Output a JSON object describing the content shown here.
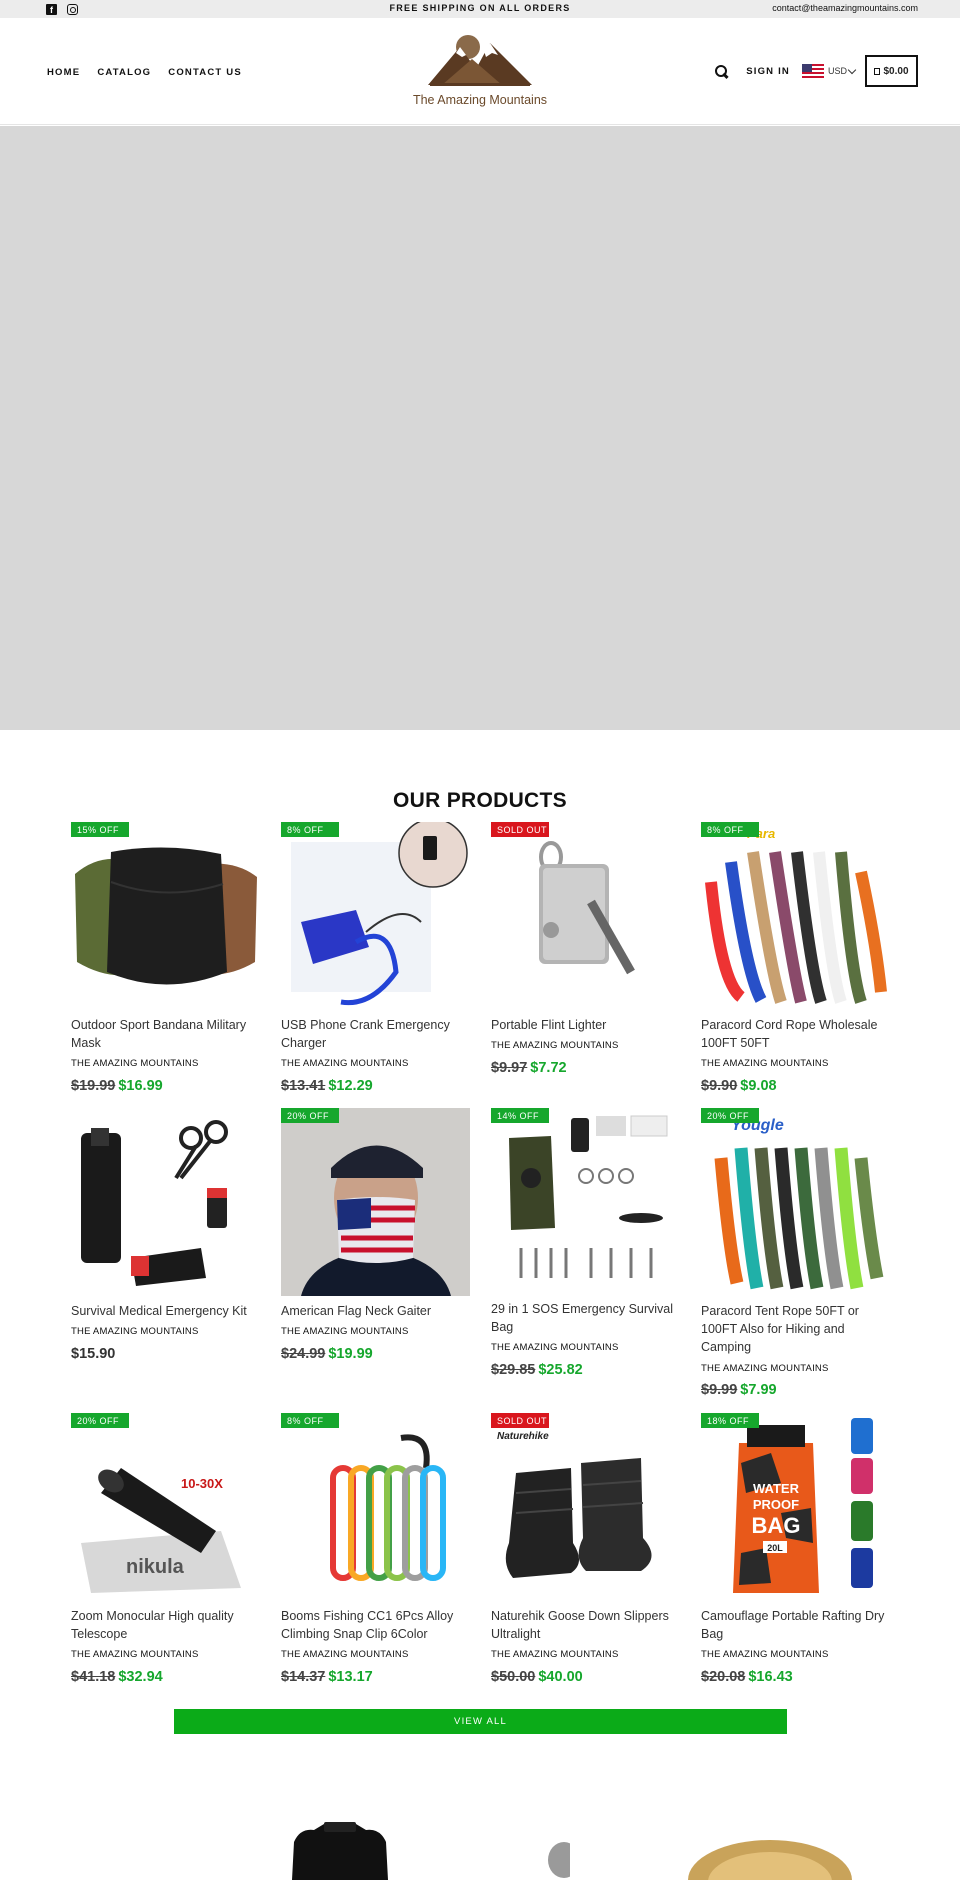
{
  "announcement": {
    "text": "FREE SHIPPING ON ALL ORDERS",
    "email": "contact@theamazingmountains.com"
  },
  "nav": [
    "HOME",
    "CATALOG",
    "CONTACT US"
  ],
  "brand": "The Amazing Mountains",
  "header": {
    "signin": "SIGN IN",
    "currency": "USD",
    "cart_total": "$0.00"
  },
  "section_title": "OUR PRODUCTS",
  "products": [
    {
      "title": "Outdoor Sport Bandana Military Mask",
      "vendor": "THE AMAZING MOUNTAINS",
      "old": "$19.99",
      "new": "$16.99",
      "badge": "15% OFF"
    },
    {
      "title": "USB Phone Crank Emergency Charger",
      "vendor": "THE AMAZING MOUNTAINS",
      "old": "$13.41",
      "new": "$12.29",
      "badge": "8% OFF"
    },
    {
      "title": "Portable Flint Lighter",
      "vendor": "THE AMAZING MOUNTAINS",
      "old": "$9.97",
      "new": "$7.72",
      "badge": "SOLD OUT"
    },
    {
      "title": "Paracord Cord Rope Wholesale 100FT 50FT",
      "vendor": "THE AMAZING MOUNTAINS",
      "old": "$9.90",
      "new": "$9.08",
      "badge": "8% OFF"
    },
    {
      "title": "Survival Medical Emergency Kit",
      "vendor": "THE AMAZING MOUNTAINS",
      "old": "",
      "new": "$15.90",
      "badge": ""
    },
    {
      "title": "American Flag Neck Gaiter",
      "vendor": "THE AMAZING MOUNTAINS",
      "old": "$24.99",
      "new": "$19.99",
      "badge": "20% OFF"
    },
    {
      "title": "29 in 1 SOS Emergency Survival Bag",
      "vendor": "THE AMAZING MOUNTAINS",
      "old": "$29.85",
      "new": "$25.82",
      "badge": "14% OFF"
    },
    {
      "title": "Paracord Tent Rope 50FT or 100FT Also for Hiking and Camping",
      "vendor": "THE AMAZING MOUNTAINS",
      "old": "$9.99",
      "new": "$7.99",
      "badge": "20% OFF"
    },
    {
      "title": "Zoom Monocular High quality Telescope",
      "vendor": "THE AMAZING MOUNTAINS",
      "old": "$41.18",
      "new": "$32.94",
      "badge": "20% OFF"
    },
    {
      "title": "Booms Fishing CC1 6Pcs Alloy Climbing Snap Clip 6Color",
      "vendor": "THE AMAZING MOUNTAINS",
      "old": "$14.37",
      "new": "$13.17",
      "badge": "8% OFF"
    },
    {
      "title": "Naturehik Goose Down Slippers Ultralight",
      "vendor": "THE AMAZING MOUNTAINS",
      "old": "$50.00",
      "new": "$40.00",
      "badge": "SOLD OUT"
    },
    {
      "title": "Camouflage Portable Rafting Dry Bag",
      "vendor": "THE AMAZING MOUNTAINS",
      "old": "$20.08",
      "new": "$16.43",
      "badge": "18% OFF"
    }
  ],
  "image_text": {
    "monocular_zoom": "10-30X",
    "monocular_brand": "nikula",
    "slipper_brand": "Naturehike",
    "drybag_line1": "WATER",
    "drybag_line2": "PROOF",
    "drybag_line3": "BAG",
    "drybag_size": "20L",
    "paracord_brand": "Yougle",
    "paracord_brand2": "Para"
  },
  "view_all": "VIEW ALL",
  "colors": {
    "sale": "#16a72d",
    "sold_out": "#d9161d",
    "button": "#0bab18",
    "hero": "#d7d7d7"
  }
}
